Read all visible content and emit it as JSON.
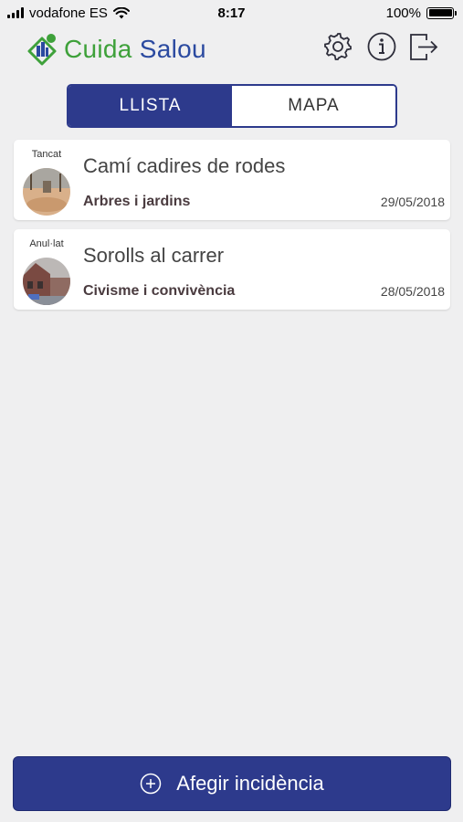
{
  "status_bar": {
    "carrier": "vodafone ES",
    "time": "8:17",
    "battery": "100%",
    "battery_level": 1.0
  },
  "header": {
    "logo": {
      "part1": "Cuida ",
      "part2": "Salou"
    },
    "icons": [
      "gear-icon",
      "info-icon",
      "logout-icon"
    ]
  },
  "tabs": [
    {
      "label": "LLISTA",
      "active": true
    },
    {
      "label": "MAPA",
      "active": false
    }
  ],
  "incidents": [
    {
      "status": "Tancat",
      "title": "Camí cadires de rodes",
      "category": "Arbres i jardins",
      "date": "29/05/2018"
    },
    {
      "status": "Anul·lat",
      "title": "Sorolls al carrer",
      "category": "Civisme i convivència",
      "date": "28/05/2018"
    }
  ],
  "add_button": {
    "label": "Afegir incidència",
    "icon": "plus-circle-icon"
  },
  "colors": {
    "primary": "#2d3a8c",
    "logo_green": "#3ea13a",
    "logo_blue": "#2b4aa0",
    "background": "#efeff0"
  }
}
